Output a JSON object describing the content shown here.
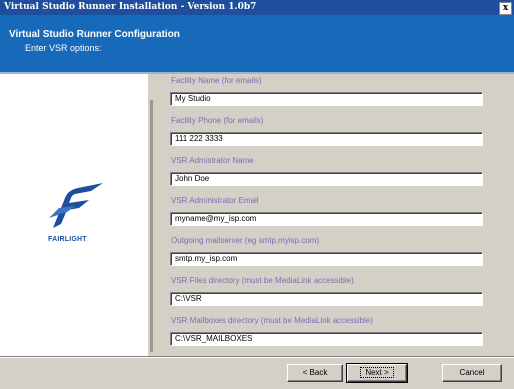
{
  "window": {
    "title": "Virtual Studio Runner Installation - Version 1.0b7",
    "close_glyph": "x"
  },
  "header": {
    "title": "Virtual Studio Runner Configuration",
    "subtitle": "Enter VSR options:"
  },
  "brand": {
    "logo_icon": "fairlight-logo-icon",
    "name": "FAIRLIGHT",
    "color": "#1d4f9e"
  },
  "fields": [
    {
      "label": "Facility Name (for emails)",
      "value": "My Studio"
    },
    {
      "label": "Facility Phone (for emails)",
      "value": "111 222 3333"
    },
    {
      "label": "VSR Admistrator Name",
      "value": "John Doe"
    },
    {
      "label": "VSR Administrator Email",
      "value": "myname@my_isp.com"
    },
    {
      "label": "Outgoing mailserver (eg smtp.myisp.com)",
      "value": "smtp.my_isp.com"
    },
    {
      "label": "VSR Files directory (must be MediaLink accessible)",
      "value": "C:\\VSR"
    },
    {
      "label": "VSR Mailboxes directory (must be MediaLink accessible)",
      "value": "C:\\VSR_MAILBOXES"
    }
  ],
  "buttons": {
    "back": "< Back",
    "next": "Next >",
    "cancel": "Cancel"
  },
  "colors": {
    "header_bg": "#1769b9",
    "titlebar_bg": "#1d4f9e",
    "label_color": "#7a6fb0"
  }
}
